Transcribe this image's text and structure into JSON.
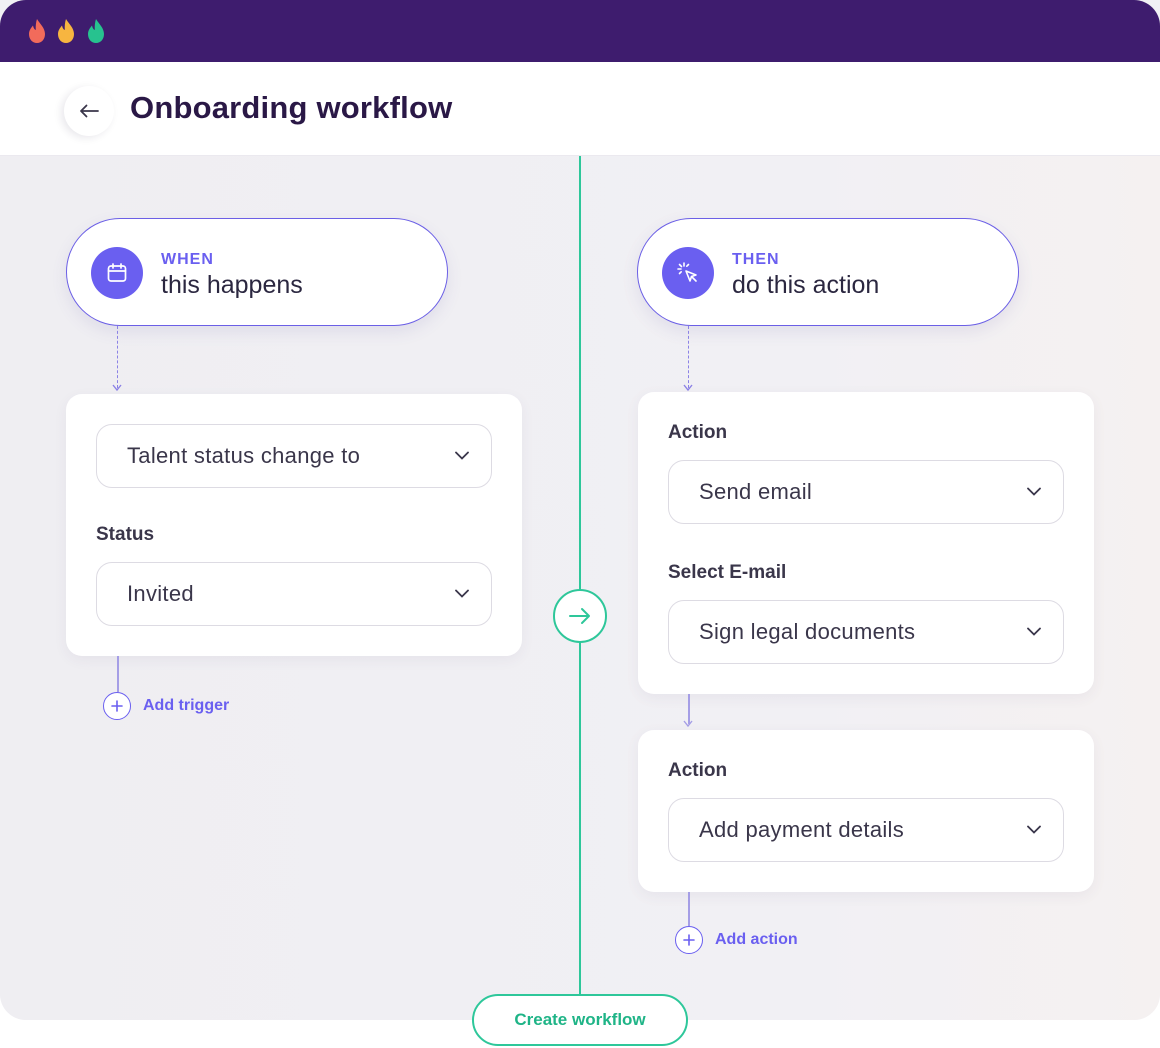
{
  "window": {
    "flames": [
      {
        "icon": "flame-icon",
        "color": "#f26b5b"
      },
      {
        "icon": "flame-icon",
        "color": "#f7b540"
      },
      {
        "icon": "flame-icon",
        "color": "#27c28f"
      }
    ],
    "title_bar_color": "#3e1c6e"
  },
  "header": {
    "back_icon": "arrow-left-icon",
    "title": "Onboarding workflow"
  },
  "trigger": {
    "kicker": "WHEN",
    "text": "this happens",
    "icon": "calendar-icon",
    "event_select": "Talent status change to",
    "status_label": "Status",
    "status_select": "Invited",
    "add_label": "Add trigger"
  },
  "actions": {
    "kicker": "THEN",
    "text": "do this action",
    "icon": "cursor-click-icon",
    "card1": {
      "action_label": "Action",
      "action_select": "Send email",
      "email_label": "Select E-mail",
      "email_select": "Sign legal documents"
    },
    "card2": {
      "action_label": "Action",
      "action_select": "Add payment details"
    },
    "add_label": "Add action"
  },
  "footer": {
    "create_button": "Create workflow"
  },
  "colors": {
    "accent": "#6a5ff0",
    "green": "#2ec79a",
    "title": "#2a1846"
  }
}
